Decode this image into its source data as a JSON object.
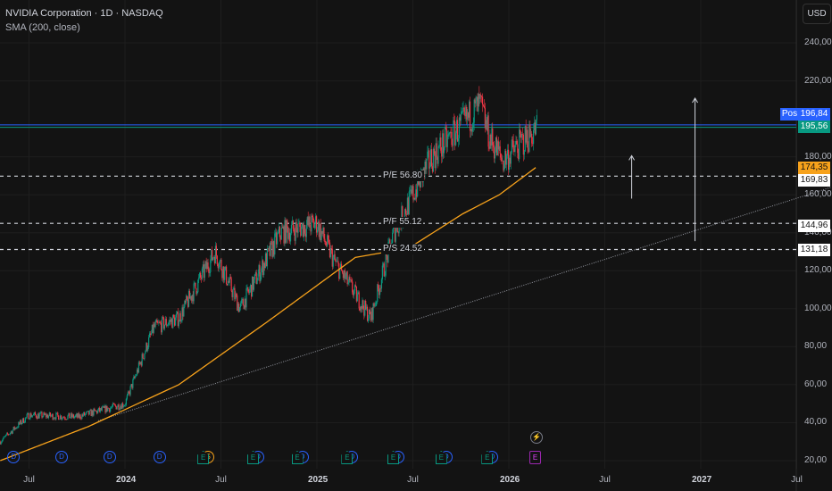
{
  "header": {
    "title": "NVIDIA Corporation · 1D · NASDAQ",
    "indicator": "SMA (200, close)",
    "currency": "USD"
  },
  "colors": {
    "up": "#089981",
    "down": "#f23645",
    "sma": "#f7a21b",
    "position": "#2962ff",
    "last": "#089981",
    "grid": "#1e1e1e"
  },
  "price_tags": {
    "pos_label": "Pos",
    "position": "196,84",
    "last": "195,56",
    "sma": "174,35",
    "pe": "169,83",
    "pf": "144,96",
    "ps": "131,18"
  },
  "chart_data": {
    "type": "candlestick",
    "title": "NVIDIA Corporation · 1D · NASDAQ",
    "ylim": [
      20,
      250
    ],
    "y_ticks": [
      "240,00",
      "220,00",
      "180,00",
      "160,00",
      "140,00",
      "120,00",
      "100,00",
      "80,00",
      "60,00",
      "40,00",
      "20,00"
    ],
    "y_tick_values": [
      240,
      220,
      180,
      160,
      140,
      120,
      100,
      80,
      60,
      40,
      20
    ],
    "x_ticks": [
      {
        "t": 2023.5,
        "label": "Jul"
      },
      {
        "t": 2024.0,
        "label": "2024"
      },
      {
        "t": 2024.5,
        "label": "Jul"
      },
      {
        "t": 2025.0,
        "label": "2025"
      },
      {
        "t": 2025.5,
        "label": "Jul"
      },
      {
        "t": 2026.0,
        "label": "2026"
      },
      {
        "t": 2026.5,
        "label": "Jul"
      },
      {
        "t": 2027.0,
        "label": "2027"
      },
      {
        "t": 2027.5,
        "label": "Jul"
      }
    ],
    "price_path": [
      [
        2023.35,
        30
      ],
      [
        2023.5,
        44
      ],
      [
        2023.75,
        43
      ],
      [
        2024.0,
        50
      ],
      [
        2024.15,
        90
      ],
      [
        2024.28,
        95
      ],
      [
        2024.47,
        130
      ],
      [
        2024.6,
        100
      ],
      [
        2024.81,
        140
      ],
      [
        2025.0,
        145
      ],
      [
        2025.09,
        125
      ],
      [
        2025.28,
        95
      ],
      [
        2025.4,
        140
      ],
      [
        2025.6,
        180
      ],
      [
        2025.85,
        207
      ],
      [
        2025.9,
        190
      ],
      [
        2025.97,
        178
      ],
      [
        2026.15,
        195.56
      ]
    ],
    "sma_200": [
      [
        2023.35,
        20
      ],
      [
        2023.81,
        38
      ],
      [
        2024.28,
        60
      ],
      [
        2024.74,
        93
      ],
      [
        2025.2,
        127
      ],
      [
        2025.48,
        132
      ],
      [
        2025.76,
        150
      ],
      [
        2025.95,
        160
      ],
      [
        2026.14,
        174.35
      ]
    ],
    "trendline": [
      [
        2023.86,
        41
      ],
      [
        2027.68,
        164
      ]
    ],
    "levels": [
      {
        "value": 169.83,
        "label": "P/E 56.80"
      },
      {
        "value": 144.96,
        "label": "P/F 55.12"
      },
      {
        "value": 131.18,
        "label": "P/S 24.52"
      }
    ],
    "position_lines": [
      196.84,
      195.56
    ],
    "arrows": [
      {
        "t": 2026.64,
        "from": 158,
        "to": 180.6
      },
      {
        "t": 2026.97,
        "from": 135.6,
        "to": 210.9
      }
    ]
  },
  "events": [
    {
      "t": 2023.42,
      "types": [
        "D"
      ]
    },
    {
      "t": 2023.67,
      "types": [
        "D"
      ]
    },
    {
      "t": 2023.92,
      "types": [
        "D"
      ]
    },
    {
      "t": 2024.18,
      "types": [
        "D"
      ]
    },
    {
      "t": 2024.41,
      "types": [
        "E",
        "S"
      ]
    },
    {
      "t": 2024.67,
      "types": [
        "E",
        "D"
      ]
    },
    {
      "t": 2024.9,
      "types": [
        "E",
        "D"
      ]
    },
    {
      "t": 2025.16,
      "types": [
        "E",
        "D"
      ]
    },
    {
      "t": 2025.4,
      "types": [
        "E",
        "D"
      ]
    },
    {
      "t": 2025.65,
      "types": [
        "E",
        "D"
      ]
    },
    {
      "t": 2025.89,
      "types": [
        "E",
        "D"
      ]
    },
    {
      "t": 2026.14,
      "types": [
        "E"
      ]
    }
  ]
}
